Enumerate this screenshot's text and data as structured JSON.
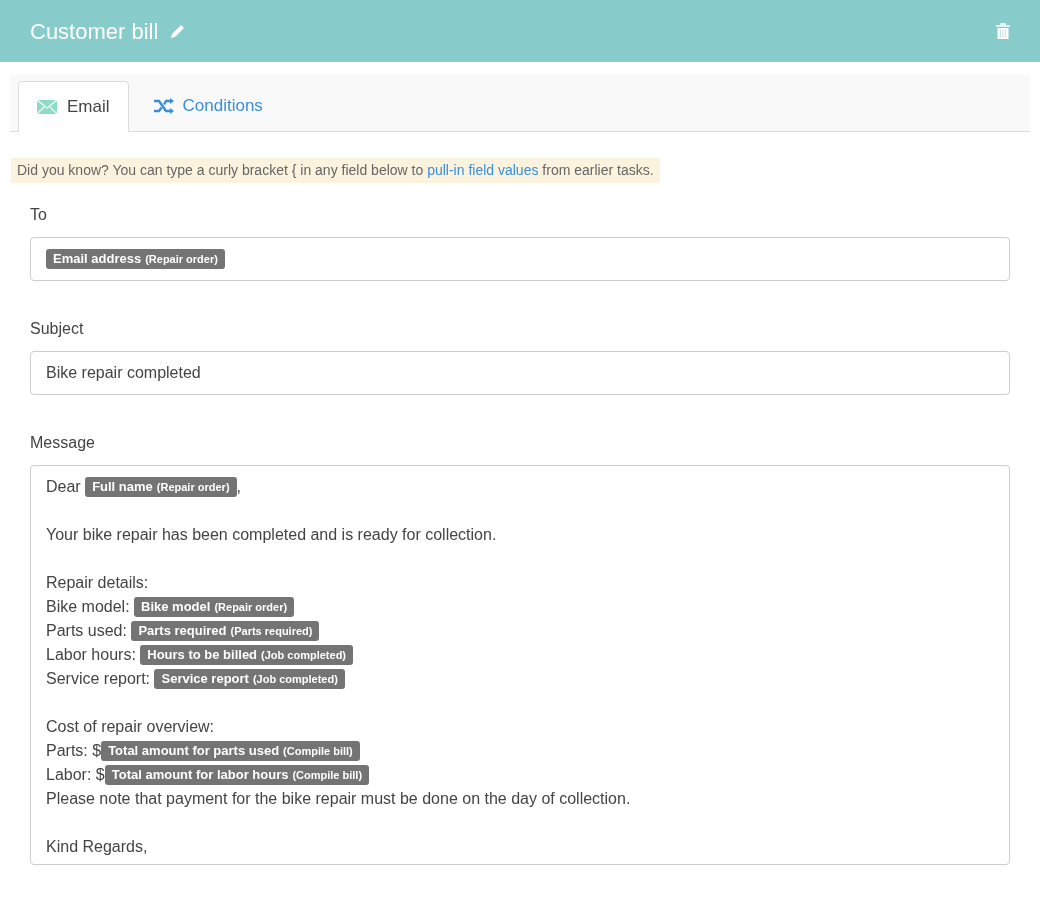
{
  "header": {
    "title": "Customer bill"
  },
  "tabs": [
    {
      "label": "Email",
      "kind": "email",
      "selected": true
    },
    {
      "label": "Conditions",
      "kind": "conditions",
      "selected": false
    }
  ],
  "hint": {
    "before": "Did you know? You can type a curly bracket { in any field below to ",
    "link": "pull-in field values",
    "after": " from earlier tasks."
  },
  "fields": [
    {
      "label": "To",
      "kind": "tags",
      "tags": [
        {
          "name": "Email address",
          "source": "(Repair order)"
        }
      ]
    },
    {
      "label": "Subject",
      "kind": "text",
      "value": "Bike repair completed"
    }
  ],
  "message": {
    "label": "Message",
    "paragraphs": [
      {
        "lines": [
          {
            "parts": [
              {
                "kind": "text",
                "text": "Dear "
              },
              {
                "kind": "tag",
                "name": "Full name",
                "source": "(Repair order)"
              },
              {
                "kind": "text",
                "text": ","
              }
            ]
          }
        ]
      },
      {
        "lines": [
          {
            "parts": [
              {
                "kind": "text",
                "text": "Your bike repair has been completed and is ready for collection."
              }
            ]
          }
        ]
      },
      {
        "lines": [
          {
            "parts": [
              {
                "kind": "text",
                "text": "Repair details:"
              }
            ]
          },
          {
            "parts": [
              {
                "kind": "text",
                "text": "Bike model: "
              },
              {
                "kind": "tag",
                "name": "Bike model",
                "source": "(Repair order)"
              }
            ]
          },
          {
            "parts": [
              {
                "kind": "text",
                "text": "Parts used: "
              },
              {
                "kind": "tag",
                "name": "Parts required",
                "source": "(Parts required)"
              }
            ]
          },
          {
            "parts": [
              {
                "kind": "text",
                "text": "Labor hours: "
              },
              {
                "kind": "tag",
                "name": "Hours to be billed",
                "source": "(Job completed)"
              }
            ]
          },
          {
            "parts": [
              {
                "kind": "text",
                "text": "Service report: "
              },
              {
                "kind": "tag",
                "name": "Service report",
                "source": "(Job completed)"
              }
            ]
          }
        ]
      },
      {
        "lines": [
          {
            "parts": [
              {
                "kind": "text",
                "text": "Cost of repair overview:"
              }
            ]
          },
          {
            "parts": [
              {
                "kind": "text",
                "text": "Parts: $"
              },
              {
                "kind": "tag",
                "name": "Total amount for parts used",
                "source": "(Compile bill)"
              }
            ]
          },
          {
            "parts": [
              {
                "kind": "text",
                "text": "Labor: $"
              },
              {
                "kind": "tag",
                "name": "Total amount for labor hours",
                "source": "(Compile bill)"
              }
            ]
          },
          {
            "parts": [
              {
                "kind": "text",
                "text": "Please note that payment for the bike repair must be done on the day of collection."
              }
            ]
          }
        ]
      },
      {
        "lines": [
          {
            "parts": [
              {
                "kind": "text",
                "text": "Kind Regards,"
              }
            ]
          }
        ]
      }
    ]
  }
}
